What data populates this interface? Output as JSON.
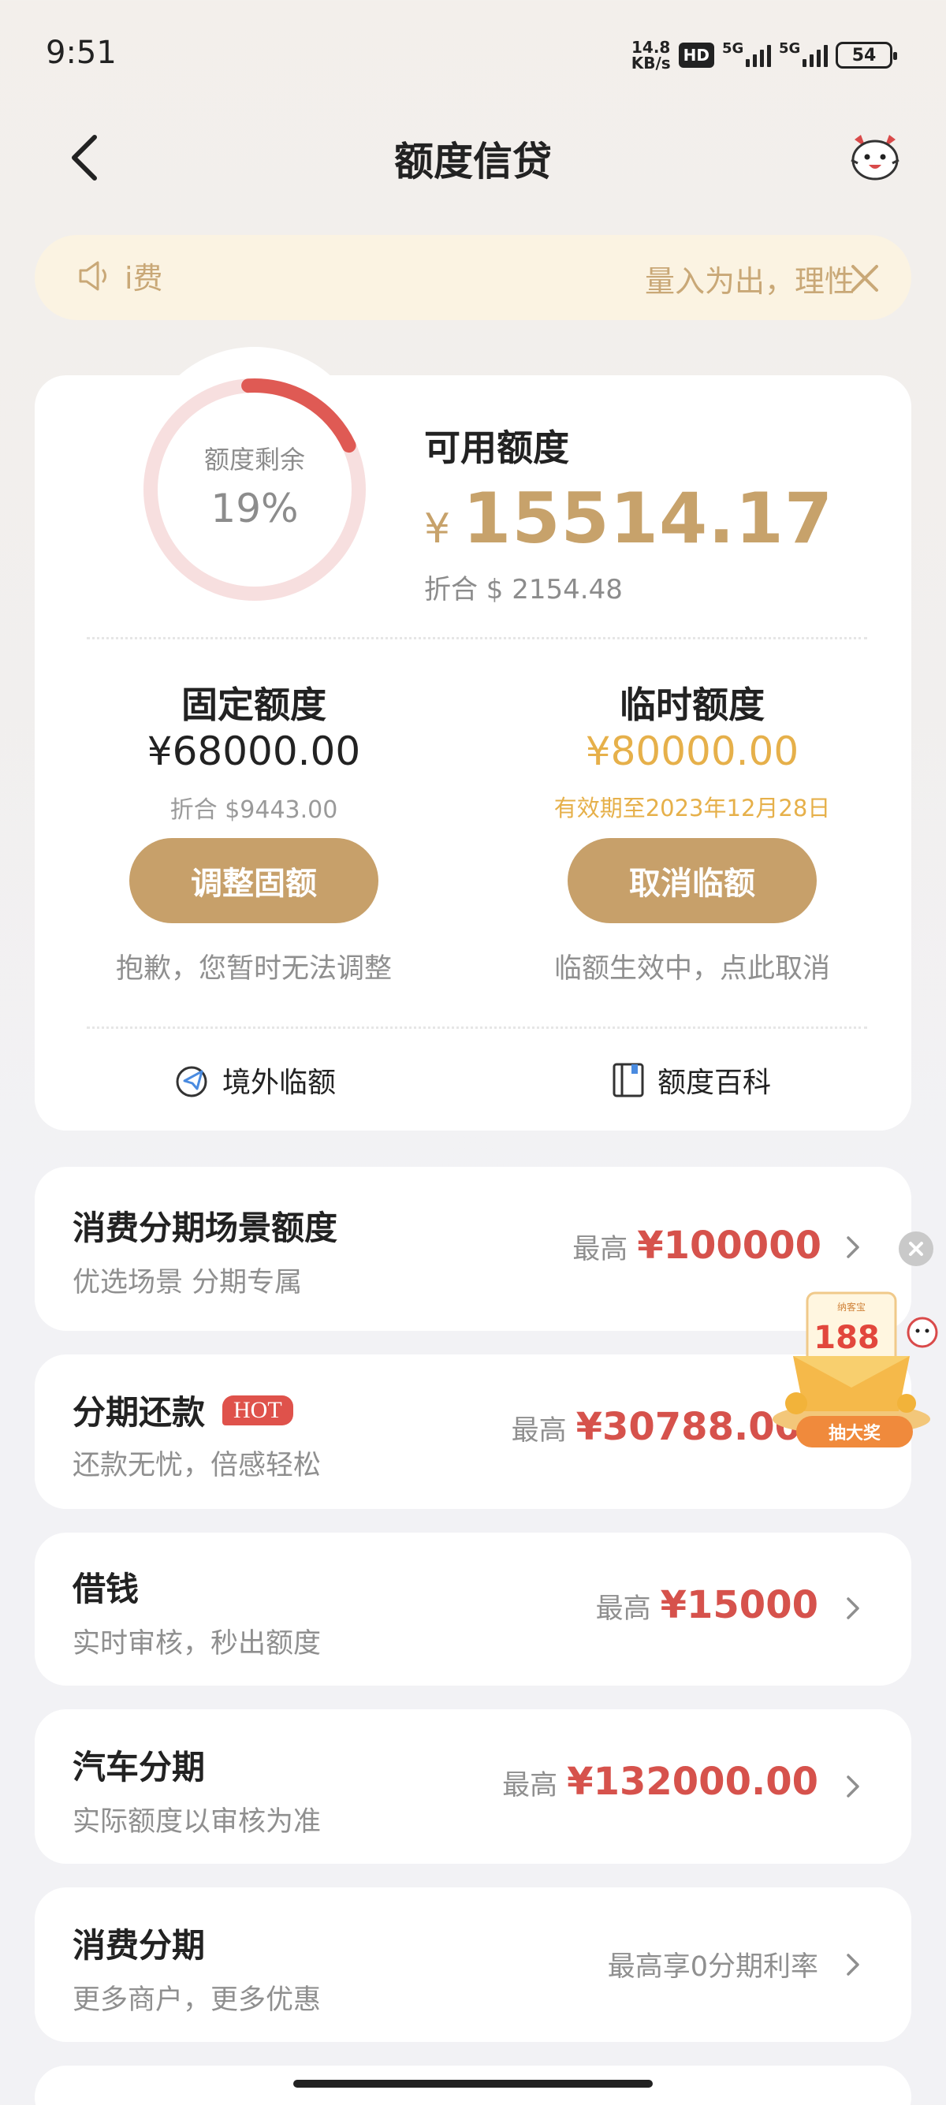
{
  "status_bar": {
    "time": "9:51",
    "net_speed_value": "14.8",
    "net_speed_unit": "KB/s",
    "hd_badge": "HD",
    "signal1_label": "5G",
    "signal2_label": "5G",
    "battery": "54"
  },
  "header": {
    "title": "额度信贷",
    "back_icon": "chevron-left-icon",
    "avatar_icon": "mascot-icon"
  },
  "notice": {
    "left_text": "i费",
    "right_text": "量入为出，理性",
    "speaker_icon": "speaker-icon",
    "close_icon": "close-icon"
  },
  "quota": {
    "ring_label": "额度剩余",
    "ring_percent": "19%",
    "ring_fraction": 0.19,
    "available_label": "可用额度",
    "currency": "¥",
    "available_amount": "15514.17",
    "available_converted": "折合 $ 2154.48",
    "fixed": {
      "title": "固定额度",
      "amount": "¥68000.00",
      "converted": "折合 $9443.00",
      "button": "调整固额",
      "note": "抱歉，您暂时无法调整"
    },
    "temporary": {
      "title": "临时额度",
      "amount": "¥80000.00",
      "expiry": "有效期至2023年12月28日",
      "button": "取消临额",
      "note": "临额生效中，点此取消"
    },
    "links": {
      "overseas": "境外临额",
      "wiki": "额度百科"
    }
  },
  "rows": [
    {
      "title": "消费分期场景额度",
      "subtitle": "优选场景 分期专属",
      "prefix": "最高",
      "value": "¥100000"
    },
    {
      "title": "分期还款",
      "badge": "HOT",
      "subtitle": "还款无忧，倍感轻松",
      "prefix": "最高",
      "value": "¥30788.00"
    },
    {
      "title": "借钱",
      "subtitle": "实时审核，秒出额度",
      "prefix": "最高",
      "value": "¥15000"
    },
    {
      "title": "汽车分期",
      "subtitle": "实际额度以审核为准",
      "prefix": "最高",
      "value": "¥132000.00"
    },
    {
      "title": "消费分期",
      "subtitle": "更多商户，更多优惠",
      "text": "最高享0分期利率"
    }
  ],
  "promo": {
    "amount": "188",
    "top_text": "纳客宝",
    "button": "抽大奖"
  },
  "colors": {
    "gold": "#c7a26b",
    "orange": "#e6b04a",
    "red": "#d6524c",
    "ring_red": "#df5a54",
    "ring_bg": "#f7dfdf"
  }
}
